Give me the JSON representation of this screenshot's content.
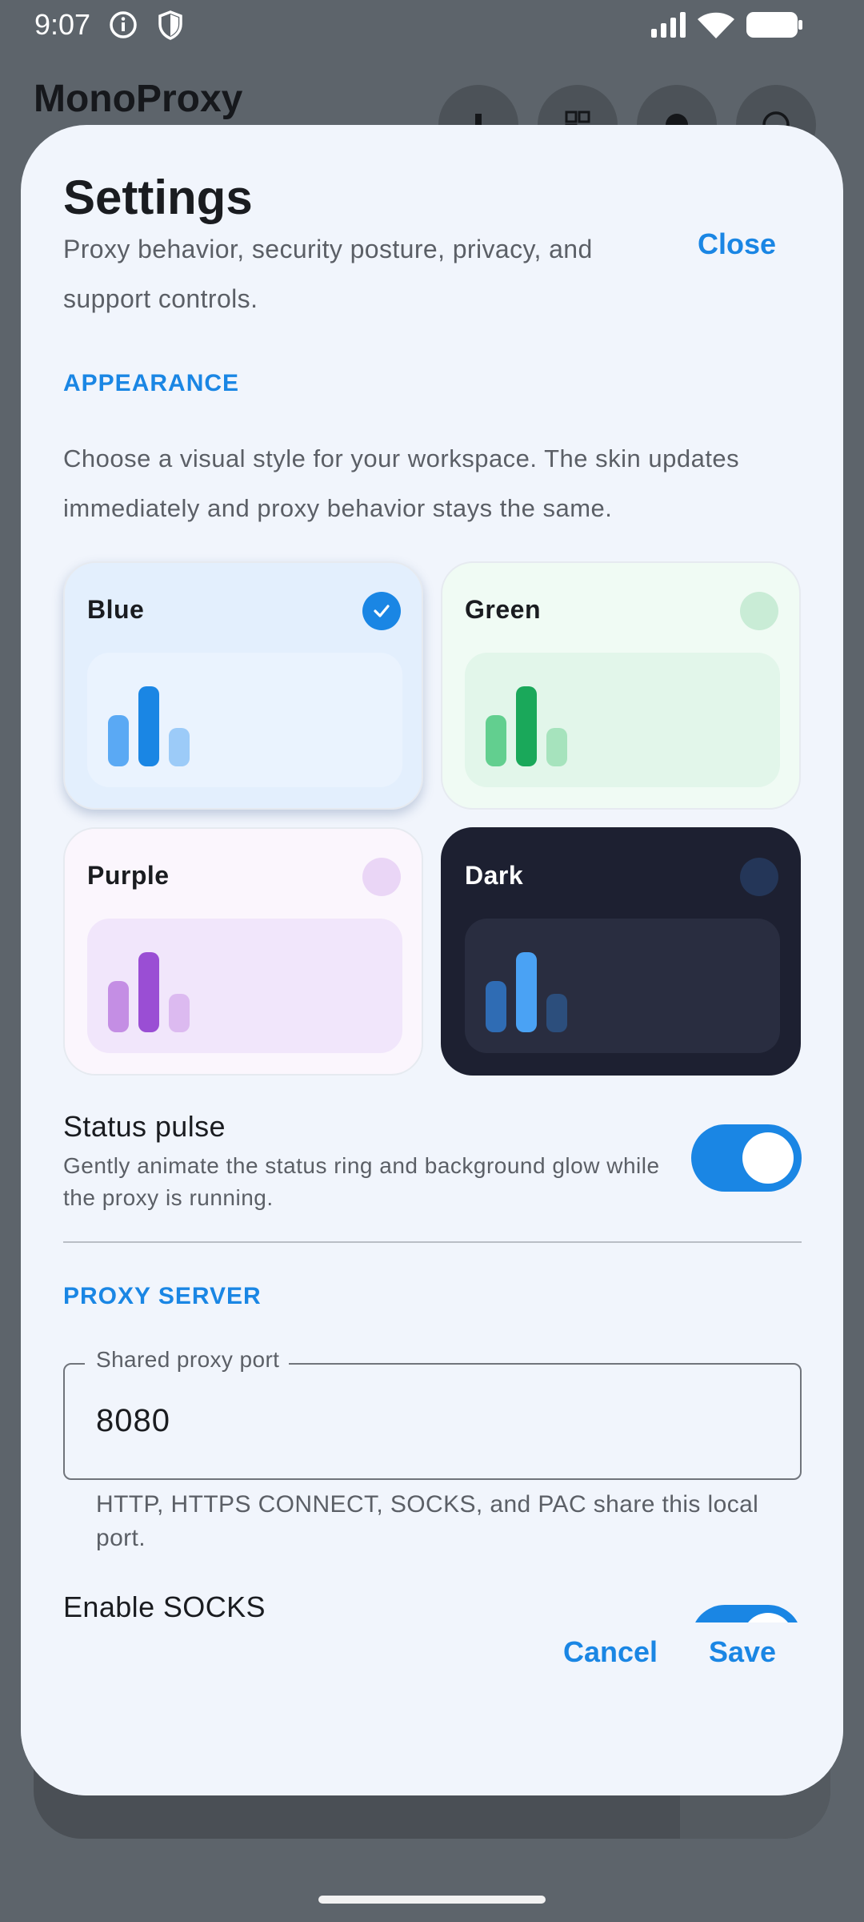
{
  "status_bar": {
    "time": "9:07",
    "icons": [
      "info-icon",
      "shield-icon",
      "signal-icon",
      "wifi-icon",
      "battery-icon"
    ]
  },
  "app": {
    "title": "MonoProxy",
    "actions": [
      "stats-icon",
      "qr-code-icon",
      "gear-icon",
      "help-icon"
    ]
  },
  "settings": {
    "title": "Settings",
    "subtitle": "Proxy behavior, security posture, privacy, and support controls.",
    "close_label": "Close",
    "appearance": {
      "heading": "APPEARANCE",
      "description": "Choose a visual style for your workspace. The skin updates immediately and proxy behavior stays the same.",
      "selected": "Blue",
      "themes": [
        {
          "name": "Blue",
          "selected": true,
          "bg": "#e3effd",
          "preview_bg": "#eaf3fe",
          "text": "#1a1c20",
          "bar_colors": [
            "#5aa9f4",
            "#1a86e4",
            "#9ccbf8"
          ],
          "indicator": "#1a86e4"
        },
        {
          "name": "Green",
          "selected": false,
          "bg": "#f0fbf4",
          "preview_bg": "#e2f6ea",
          "text": "#1a1c20",
          "bar_colors": [
            "#62cf8f",
            "#1aa85a",
            "#a6e3bd"
          ],
          "indicator": "#c9ecd6"
        },
        {
          "name": "Purple",
          "selected": false,
          "bg": "#fbf6fd",
          "preview_bg": "#f1e6fb",
          "text": "#1a1c20",
          "bar_colors": [
            "#c48ee4",
            "#9a4ed4",
            "#dcbaf0"
          ],
          "indicator": "#ead6f6"
        },
        {
          "name": "Dark",
          "selected": false,
          "bg": "#1d2031",
          "preview_bg": "#292d40",
          "text": "#ffffff",
          "bar_colors": [
            "#2f6cb4",
            "#4aa2f4",
            "#2c4e7c"
          ],
          "indicator": "#243658"
        }
      ]
    },
    "status_pulse": {
      "title": "Status pulse",
      "description": "Gently animate the status ring and background glow while the proxy is running.",
      "enabled": true
    },
    "proxy_server": {
      "heading": "PROXY SERVER",
      "port_label": "Shared proxy port",
      "port_value": "8080",
      "port_help": "HTTP, HTTPS CONNECT, SOCKS, and PAC share this local port."
    },
    "socks": {
      "title": "Enable SOCKS",
      "enabled": true
    },
    "footer": {
      "cancel_label": "Cancel",
      "save_label": "Save"
    }
  },
  "colors": {
    "accent": "#1a86e4",
    "sheet_bg": "#f1f5fc",
    "scrim": "#5d646b"
  }
}
